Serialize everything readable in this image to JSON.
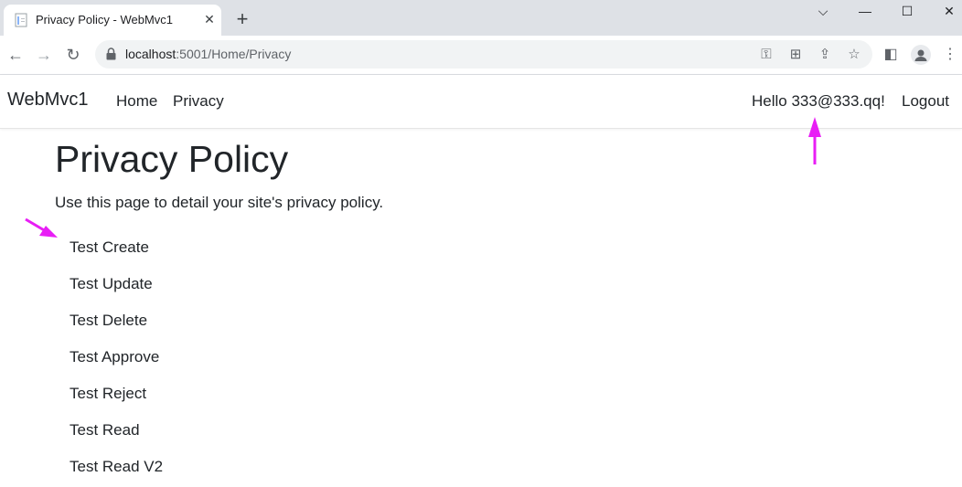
{
  "browser": {
    "tab_title": "Privacy Policy - WebMvc1",
    "url_host": "localhost",
    "url_rest": ":5001/Home/Privacy"
  },
  "navbar": {
    "brand": "WebMvc1",
    "links": [
      "Home",
      "Privacy"
    ],
    "greeting": "Hello 333@333.qq!",
    "logout": "Logout"
  },
  "main": {
    "title": "Privacy Policy",
    "lead": "Use this page to detail your site's privacy policy.",
    "actions": [
      "Test Create",
      "Test Update",
      "Test Delete",
      "Test Approve",
      "Test Reject",
      "Test Read",
      "Test Read V2"
    ]
  },
  "colors": {
    "annotation_arrow": "#e81ef5"
  }
}
